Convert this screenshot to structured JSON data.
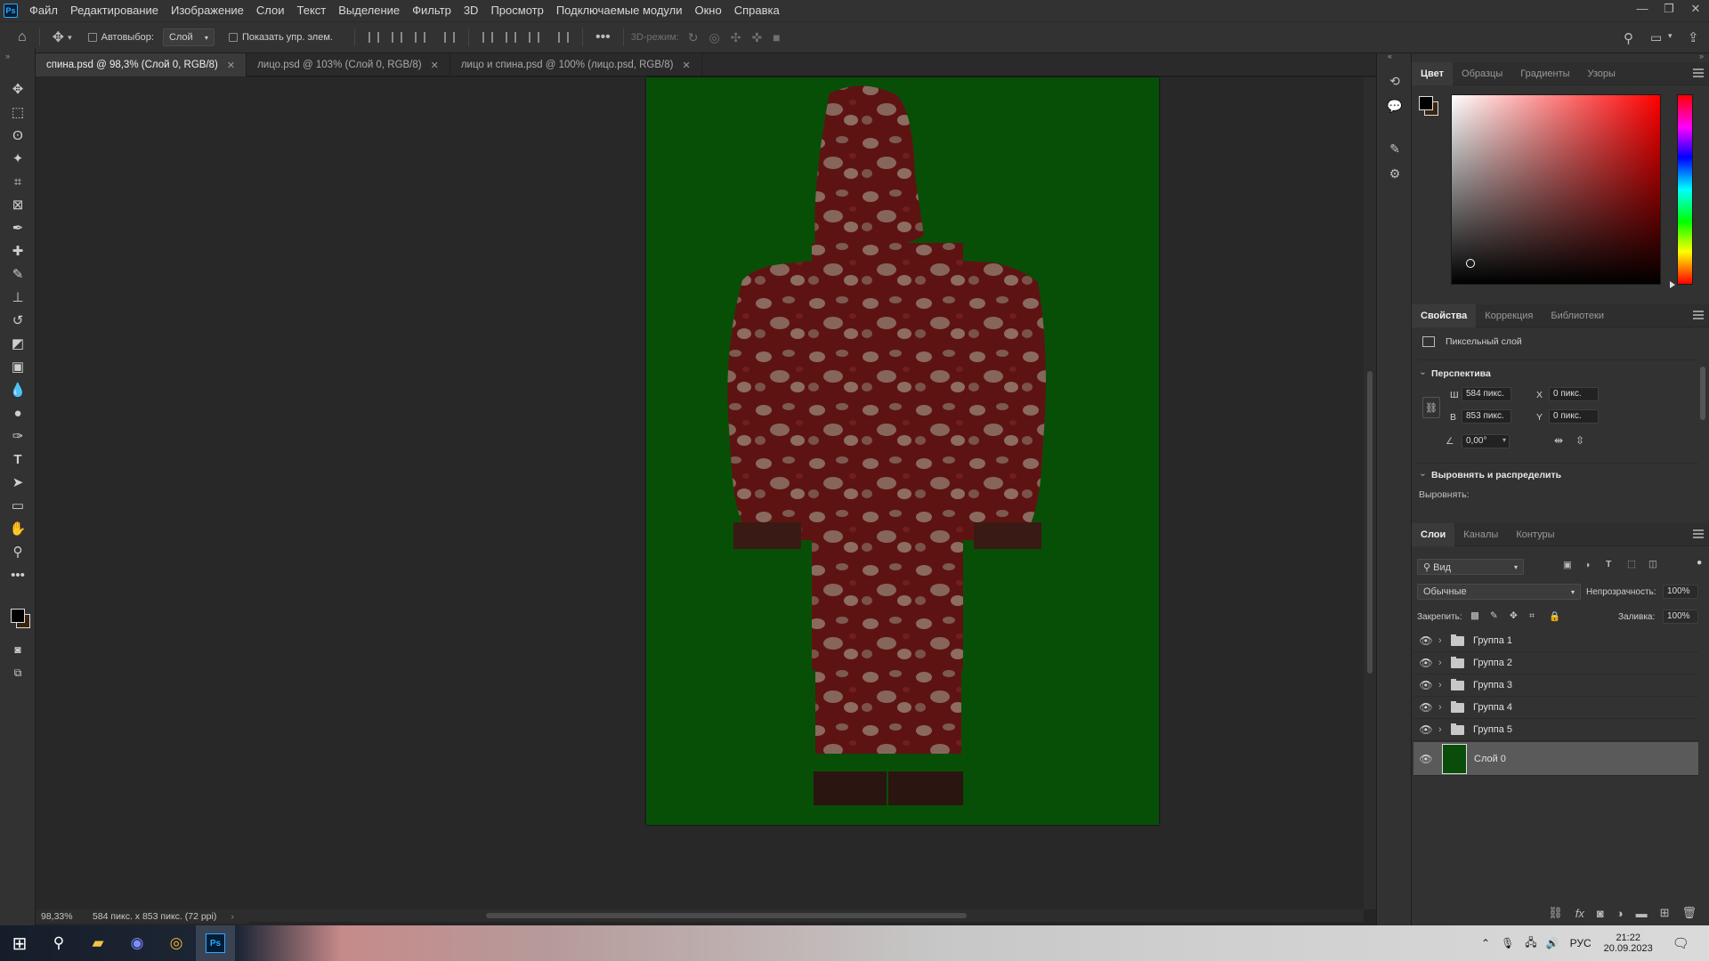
{
  "menubar": {
    "logo": "Ps",
    "items": [
      "Файл",
      "Редактирование",
      "Изображение",
      "Слои",
      "Текст",
      "Выделение",
      "Фильтр",
      "3D",
      "Просмотр",
      "Подключаемые модули",
      "Окно",
      "Справка"
    ]
  },
  "options": {
    "autoselect_label": "Автовыбор:",
    "autoselect_value": "Слой",
    "show_controls_label": "Показать упр. элем.",
    "mode_3d_label": "3D-режим:"
  },
  "tabs": [
    {
      "label": "спина.psd @ 98,3% (Слой 0, RGB/8)",
      "active": true
    },
    {
      "label": "лицо.psd @ 103% (Слой 0, RGB/8)",
      "active": false
    },
    {
      "label": "лицо и спина.psd @ 100% (лицо.psd, RGB/8)",
      "active": false
    }
  ],
  "status": {
    "zoom": "98,33%",
    "doc_info": "584 пикс. x 853 пикс. (72 ppi)"
  },
  "color_panel": {
    "tabs": [
      "Цвет",
      "Образцы",
      "Градиенты",
      "Узоры"
    ],
    "foreground": "#000000",
    "background": "#3a2410"
  },
  "properties_panel": {
    "tabs": [
      "Свойства",
      "Коррекция",
      "Библиотеки"
    ],
    "layer_type": "Пиксельный слой",
    "section_perspective": "Перспектива",
    "w_label": "Ш",
    "w_value": "584 пикс.",
    "h_label": "В",
    "h_value": "853 пикс.",
    "x_label": "X",
    "x_value": "0 пикс.",
    "y_label": "Y",
    "y_value": "0 пикс.",
    "angle_value": "0,00°",
    "section_align": "Выровнять и распределить",
    "align_label": "Выровнять:"
  },
  "layers_panel": {
    "tabs": [
      "Слои",
      "Каналы",
      "Контуры"
    ],
    "filter_label": "Вид",
    "blend_mode": "Обычные",
    "opacity_label": "Непрозрачность:",
    "opacity_value": "100%",
    "lock_label": "Закрепить:",
    "fill_label": "Заливка:",
    "fill_value": "100%",
    "groups": [
      "Группа 1",
      "Группа 2",
      "Группа 3",
      "Группа 4",
      "Группа 5"
    ],
    "layer": "Слой 0"
  },
  "taskbar": {
    "lang": "РУС",
    "time": "21:22",
    "date": "20.09.2023",
    "app_ps": "Ps"
  },
  "icons": [
    "home-icon",
    "move-icon",
    "marquee-icon",
    "lasso-icon",
    "magic-wand-icon",
    "crop-icon",
    "frame-icon",
    "eyedropper-icon",
    "healing-icon",
    "brush-icon",
    "stamp-icon",
    "history-brush-icon",
    "eraser-icon",
    "gradient-icon",
    "blur-icon",
    "dodge-icon",
    "pen-icon",
    "type-icon",
    "path-select-icon",
    "rectangle-icon",
    "hand-icon",
    "zoom-icon",
    "more-icon",
    "search-icon",
    "workspace-icon",
    "share-icon",
    "eye-icon",
    "folder-icon"
  ]
}
